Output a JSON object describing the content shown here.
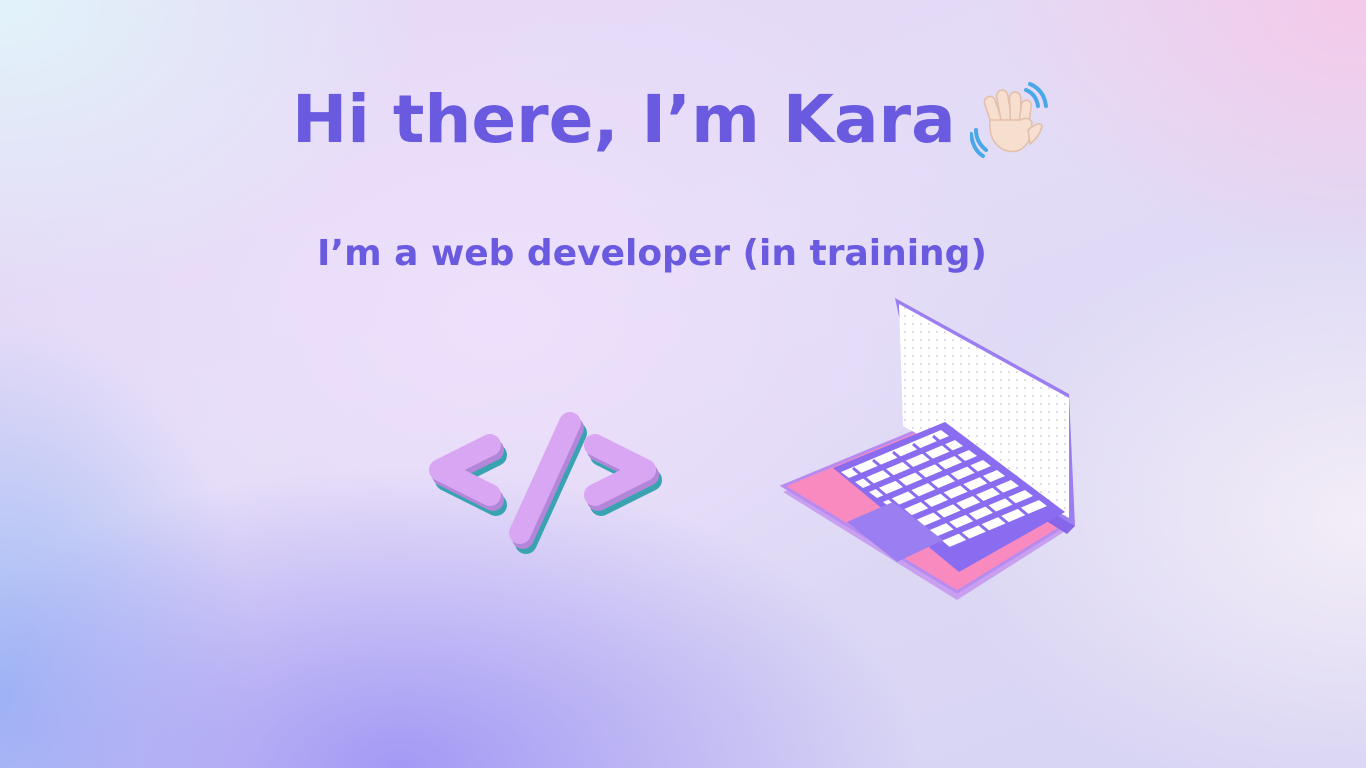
{
  "hero": {
    "greeting": "Hi there, I’m Kara",
    "tagline": "I’m a web developer (in training)"
  },
  "icons": {
    "wave": "waving-hand-icon",
    "code": "code-tag-icon",
    "laptop": "laptop-icon"
  },
  "colors": {
    "heading": "#6a5ae0",
    "code_face": "#d9a6f3",
    "code_shadow": "#3aa3b2",
    "laptop_base": "#f98ac0",
    "laptop_frame": "#9b7ff2"
  }
}
